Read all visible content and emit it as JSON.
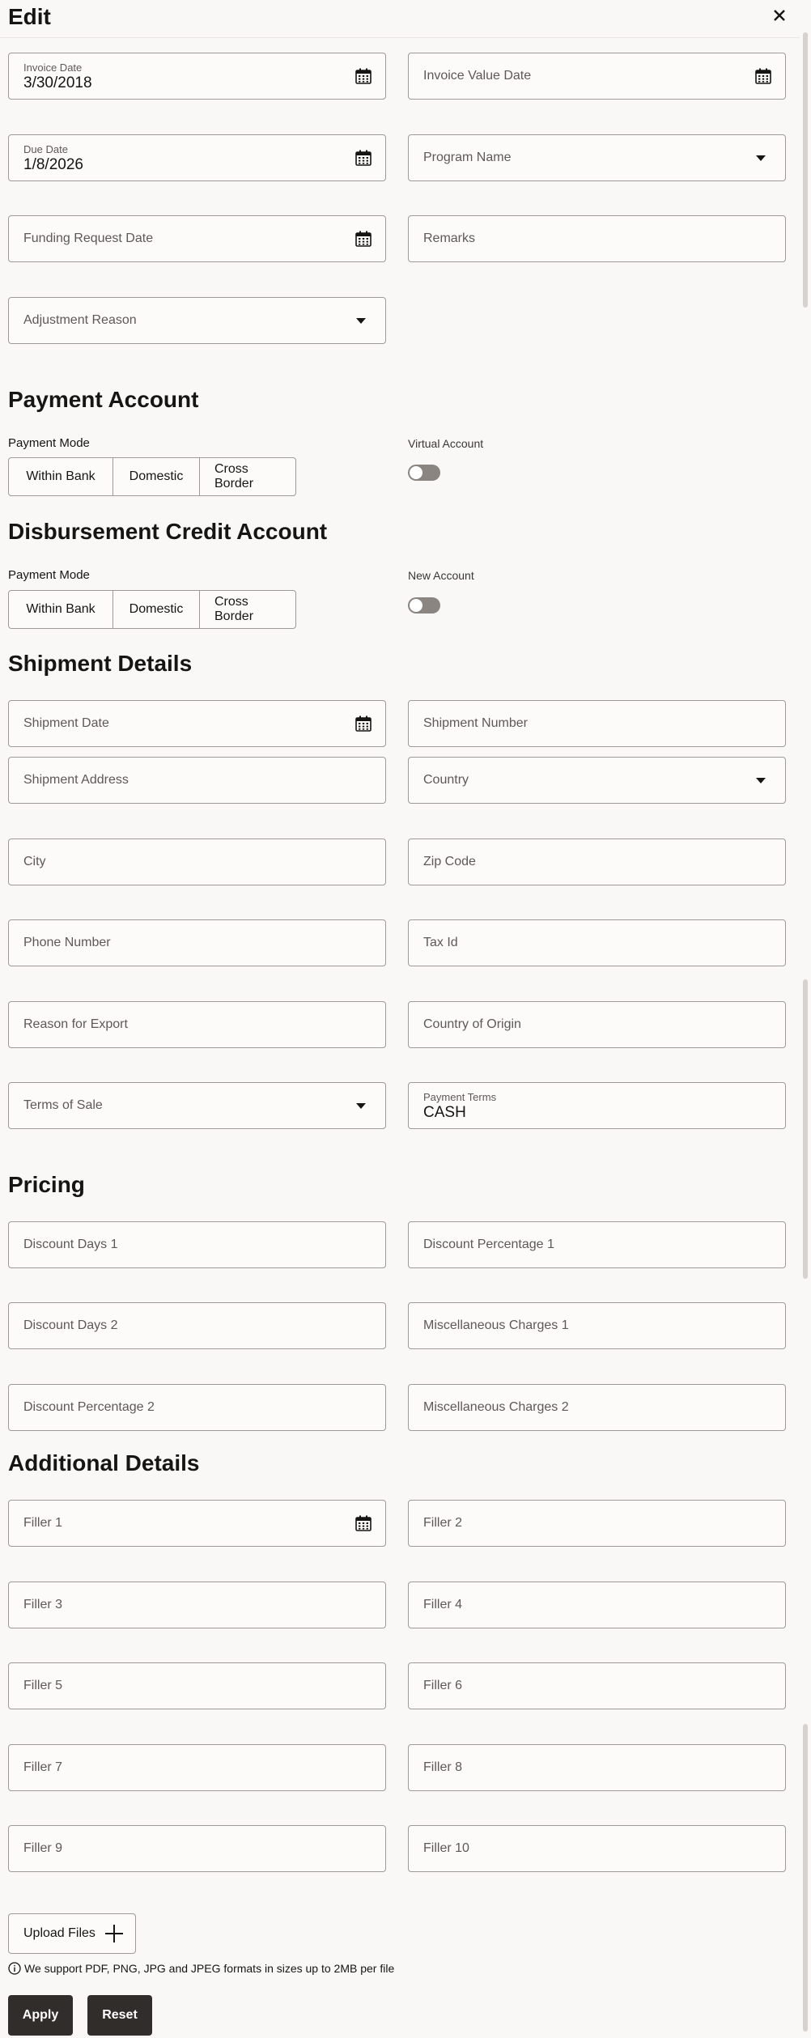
{
  "header": {
    "title": "Edit"
  },
  "invoice": {
    "invoice_date_label": "Invoice Date",
    "invoice_date_value": "3/30/2018",
    "invoice_value_date_label": "Invoice Value Date",
    "due_date_label": "Due Date",
    "due_date_value": "1/8/2026",
    "program_name_label": "Program Name",
    "funding_request_date_label": "Funding Request Date",
    "remarks_label": "Remarks",
    "adjustment_reason_label": "Adjustment Reason"
  },
  "payment_account": {
    "title": "Payment Account",
    "payment_mode_label": "Payment Mode",
    "modes": [
      "Within Bank",
      "Domestic",
      "Cross Border"
    ],
    "virtual_account_label": "Virtual Account"
  },
  "disbursement": {
    "title": "Disbursement Credit Account",
    "payment_mode_label": "Payment Mode",
    "modes": [
      "Within Bank",
      "Domestic",
      "Cross Border"
    ],
    "new_account_label": "New Account"
  },
  "shipment": {
    "title": "Shipment Details",
    "shipment_date": "Shipment Date",
    "shipment_number": "Shipment Number",
    "shipment_address": "Shipment Address",
    "country": "Country",
    "city": "City",
    "zip_code": "Zip Code",
    "phone_number": "Phone Number",
    "tax_id": "Tax Id",
    "reason_for_export": "Reason for Export",
    "country_of_origin": "Country of Origin",
    "terms_of_sale": "Terms of Sale",
    "payment_terms_label": "Payment Terms",
    "payment_terms_value": "CASH"
  },
  "pricing": {
    "title": "Pricing",
    "discount_days_1": "Discount Days 1",
    "discount_percentage_1": "Discount Percentage 1",
    "discount_days_2": "Discount Days 2",
    "misc_charges_1": "Miscellaneous Charges 1",
    "discount_percentage_2": "Discount Percentage 2",
    "misc_charges_2": "Miscellaneous Charges 2"
  },
  "additional": {
    "title": "Additional Details",
    "fillers": [
      "Filler 1",
      "Filler 2",
      "Filler 3",
      "Filler 4",
      "Filler 5",
      "Filler 6",
      "Filler 7",
      "Filler 8",
      "Filler 9",
      "Filler 10"
    ]
  },
  "footer": {
    "upload_label": "Upload Files",
    "support_note": "We support PDF, PNG, JPG and JPEG formats in sizes up to 2MB per file",
    "apply_label": "Apply",
    "reset_label": "Reset"
  },
  "icons": {
    "calendar": "calendar-icon",
    "dropdown": "chevron-down-icon",
    "close": "close-icon",
    "add": "plus-icon",
    "info": "info-icon"
  },
  "colors": {
    "background": "#f9f8f6",
    "border": "#9e9a95",
    "primary_button": "#312d2a",
    "toggle_off": "#8a8580"
  }
}
